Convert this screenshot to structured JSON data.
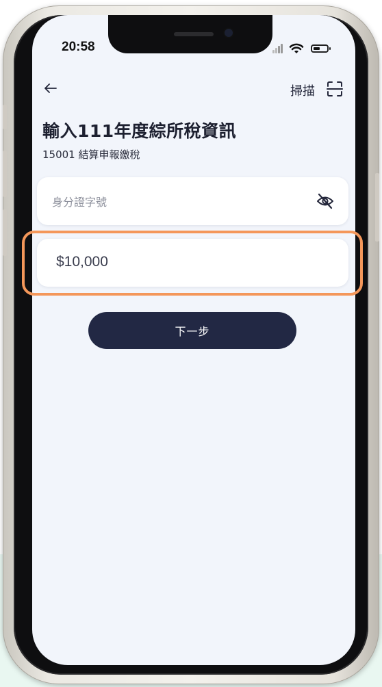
{
  "status_bar": {
    "time": "20:58"
  },
  "header": {
    "back_icon": "arrow-left-icon",
    "scan_label": "掃描",
    "scan_icon": "scan-frame-icon"
  },
  "page": {
    "title": "輸入111年度綜所稅資訊",
    "subtitle": "15001 結算申報繳稅"
  },
  "id_field": {
    "placeholder": "身分證字號",
    "value": "",
    "toggle_icon": "eye-off-icon"
  },
  "amount_field": {
    "value": "$10,000"
  },
  "next_button": {
    "label": "下一步"
  },
  "colors": {
    "primary": "#222844",
    "background": "#f2f5fb",
    "highlight": "#f4975a"
  }
}
